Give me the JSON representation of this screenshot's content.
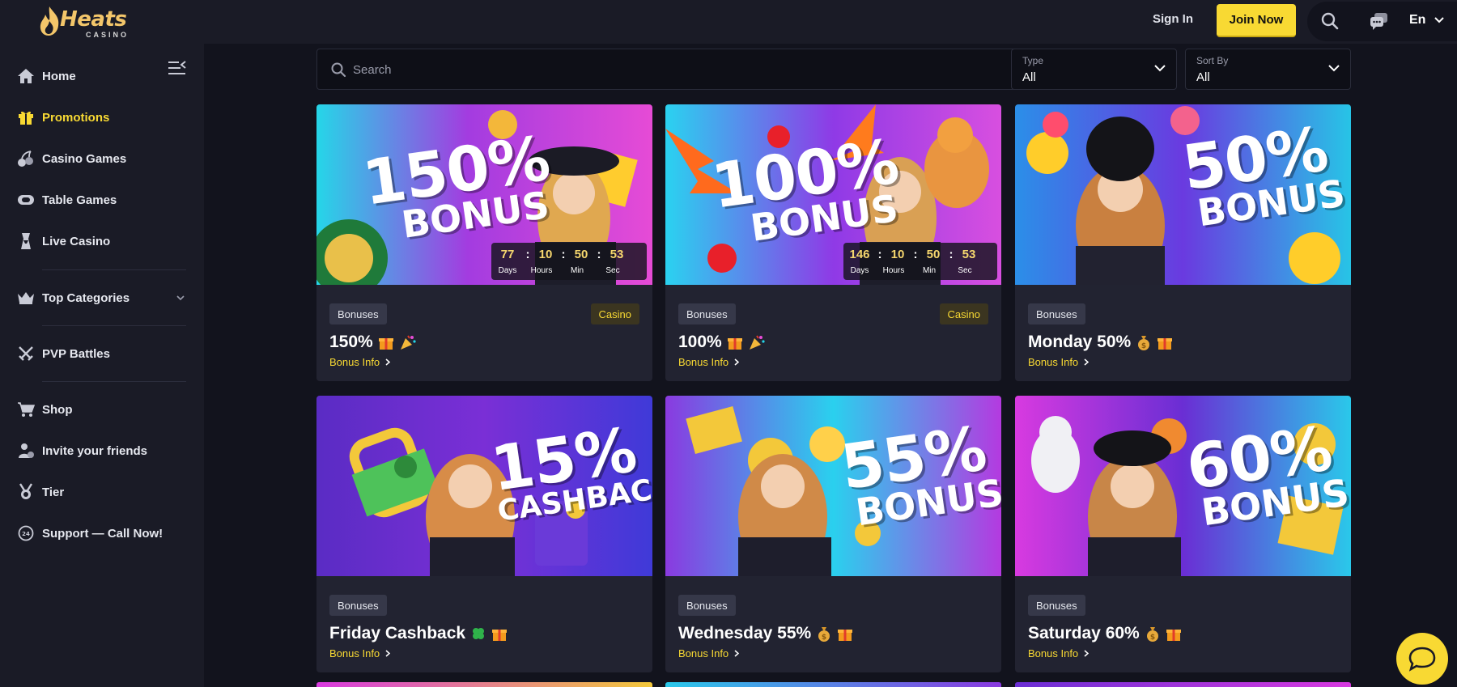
{
  "header": {
    "logo_text": "Heats",
    "logo_sub": "CASINO",
    "sign_in": "Sign In",
    "join_now": "Join Now",
    "language": "En"
  },
  "sidebar": {
    "items": [
      {
        "label": "Home",
        "icon": "home-icon"
      },
      {
        "label": "Promotions",
        "icon": "gift-icon",
        "active": true
      },
      {
        "label": "Casino Games",
        "icon": "cherry-icon"
      },
      {
        "label": "Table Games",
        "icon": "chip-icon"
      },
      {
        "label": "Live Casino",
        "icon": "dealer-icon"
      },
      {
        "label": "Top Categories",
        "icon": "crown-icon"
      },
      {
        "label": "PVP Battles",
        "icon": "swords-icon"
      },
      {
        "label": "Shop",
        "icon": "cart-icon"
      },
      {
        "label": "Invite your friends",
        "icon": "invite-icon"
      },
      {
        "label": "Tier",
        "icon": "medal-icon"
      },
      {
        "label": "Support — Call Now!",
        "icon": "support-24-icon"
      }
    ]
  },
  "filters": {
    "search_placeholder": "Search",
    "type_label": "Type",
    "type_value": "All",
    "sort_label": "Sort By",
    "sort_value": "All"
  },
  "promotions": [
    {
      "banner_big": "150%",
      "banner_small": "BONUS",
      "tag": "Bonuses",
      "tag2": "Casino",
      "title": "150%",
      "emojis": [
        "gift",
        "party"
      ],
      "link": "Bonus Info",
      "timer": {
        "days": "77",
        "hours": "10",
        "min": "50",
        "sec": "53"
      }
    },
    {
      "banner_big": "100%",
      "banner_small": "BONUS",
      "tag": "Bonuses",
      "tag2": "Casino",
      "title": "100%",
      "emojis": [
        "gift",
        "party"
      ],
      "link": "Bonus Info",
      "timer": {
        "days": "146",
        "hours": "10",
        "min": "50",
        "sec": "53"
      }
    },
    {
      "banner_big": "50%",
      "banner_small": "BONUS",
      "tag": "Bonuses",
      "title": "Monday 50%",
      "emojis": [
        "moneybag",
        "gift"
      ],
      "link": "Bonus Info"
    },
    {
      "banner_big": "15%",
      "banner_small": "CASHBACK",
      "tag": "Bonuses",
      "title": "Friday Cashback",
      "emojis": [
        "clover",
        "gift"
      ],
      "link": "Bonus Info"
    },
    {
      "banner_big": "55%",
      "banner_small": "BONUS",
      "tag": "Bonuses",
      "title": "Wednesday 55%",
      "emojis": [
        "moneybag",
        "gift"
      ],
      "link": "Bonus Info"
    },
    {
      "banner_big": "60%",
      "banner_small": "BONUS",
      "tag": "Bonuses",
      "title": "Saturday 60%",
      "emojis": [
        "moneybag",
        "gift"
      ],
      "link": "Bonus Info"
    }
  ],
  "timer_units": {
    "days": "Days",
    "hours": "Hours",
    "min": "Min",
    "sec": "Sec"
  },
  "colors": {
    "accent": "#f8d933",
    "background": "#12131d",
    "panel": "#1a1b26",
    "card": "#222331"
  }
}
